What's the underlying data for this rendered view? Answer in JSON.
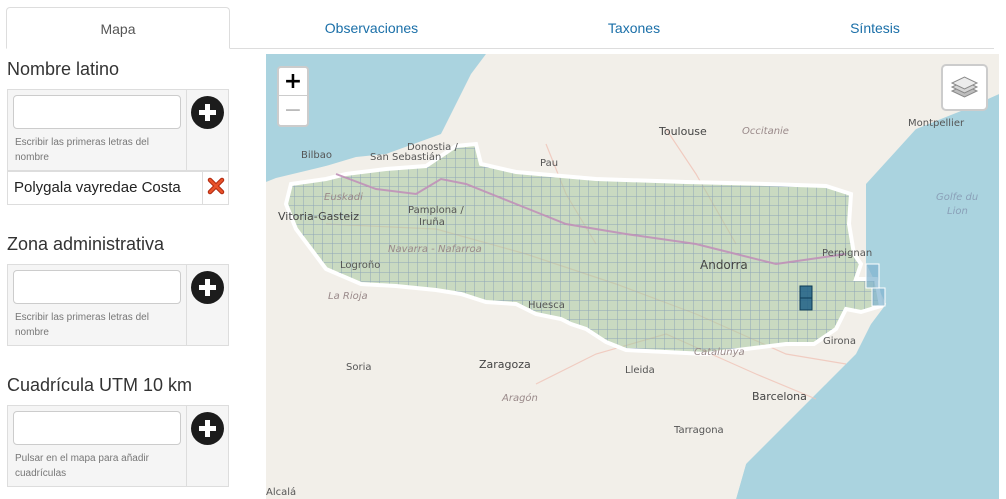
{
  "tabs": [
    {
      "label": "Mapa",
      "active": true
    },
    {
      "label": "Observaciones"
    },
    {
      "label": "Taxones"
    },
    {
      "label": "Síntesis"
    }
  ],
  "sidebar": {
    "latin_name": {
      "title": "Nombre latino",
      "input_value": "",
      "hint": "Escribir las primeras letras del nombre",
      "selected": "Polygala vayredae Costa"
    },
    "admin_zone": {
      "title": "Zona administrativa",
      "input_value": "",
      "hint": "Escribir las primeras letras del nombre"
    },
    "utm_grid": {
      "title": "Cuadrícula UTM 10 km",
      "input_value": "",
      "hint": "Pulsar en el mapa para añadir cuadrículas"
    }
  },
  "map": {
    "zoom_in": "+",
    "zoom_out": "−",
    "labels": {
      "toulouse": "Toulouse",
      "occitanie": "Occitanie",
      "montpellier": "Montpellier",
      "donostia": "Donostia /",
      "san_sebastian": "San Sebastián",
      "bilbao": "Bilbao",
      "euskadi": "Euskadi",
      "vitoria": "Vitoria-Gasteiz",
      "pamplona": "Pamplona /",
      "iruna": "Iruña",
      "navarra": "Navarra - Nafarroa",
      "pau": "Pau",
      "logrono": "Logroño",
      "la_rioja": "La Rioja",
      "andorra": "Andorra",
      "perpignan": "Perpignan",
      "golfe": "Golfe du",
      "lion": "Lion",
      "huesca": "Huesca",
      "soria": "Soria",
      "zaragoza": "Zaragoza",
      "lleida": "Lleida",
      "catalunya": "Catalunya",
      "girona": "Girona",
      "aragon": "Aragón",
      "barcelona": "Barcelona",
      "tarragona": "Tarragona",
      "alcala": "Alcalá"
    },
    "colors": {
      "land": "#f2efe9",
      "sea": "#aad3df",
      "grid_fill": "#a8c8a0",
      "grid_line": "#8fa6b8",
      "highlight": "#1f5f86",
      "border": "#c090b8"
    }
  }
}
